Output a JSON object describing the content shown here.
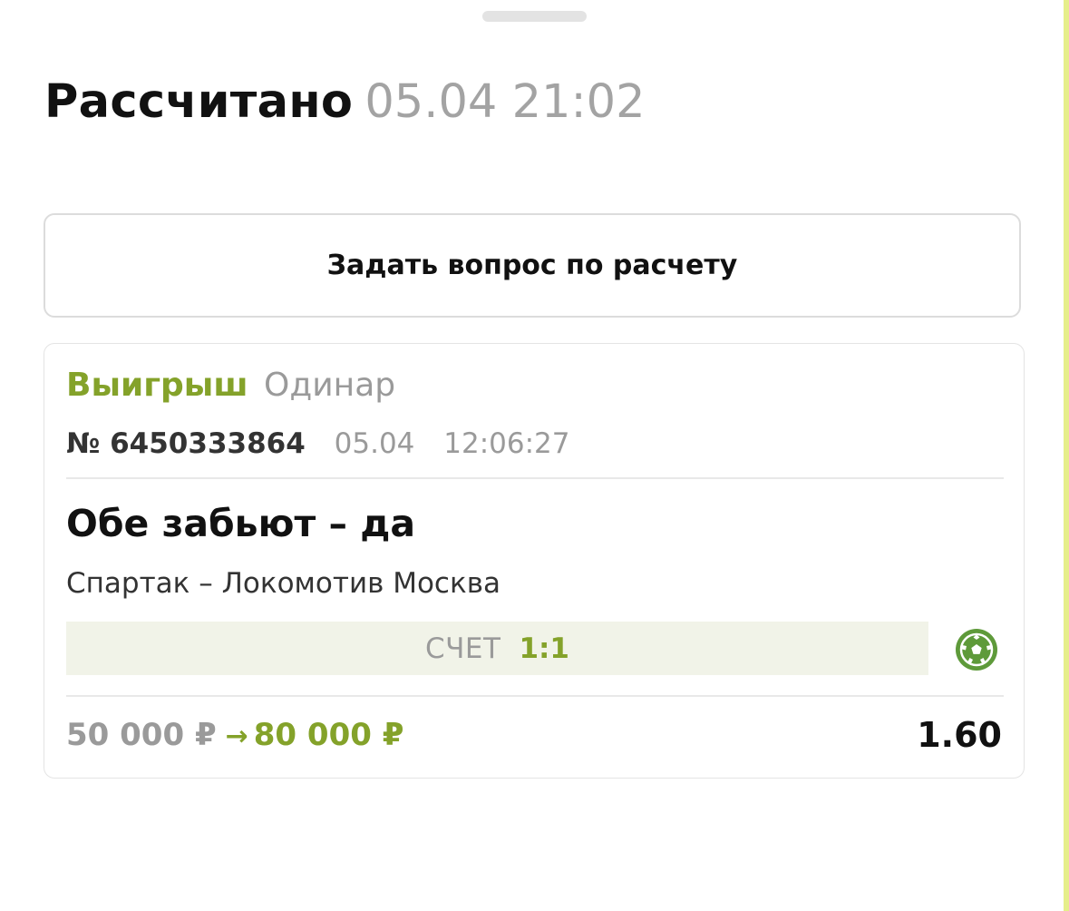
{
  "header": {
    "status_title": "Рассчитано",
    "settled_datetime": "05.04 21:02"
  },
  "actions": {
    "ask_question_label": "Задать вопрос по расчету"
  },
  "bet": {
    "result": "Выигрыш",
    "bet_type": "Одинар",
    "number": "№ 6450333864",
    "placed_date": "05.04",
    "placed_time": "12:06:27",
    "outcome": "Обе забьют – да",
    "event": "Спартак – Локомотив Москва",
    "score_label": "СЧЕТ",
    "score": "1:1",
    "sport_icon": "soccer-ball-icon",
    "stake": "50 000 ₽",
    "arrow": "→",
    "payout": "80 000 ₽",
    "odds": "1.60"
  },
  "colors": {
    "win_green": "#84a22a",
    "score_bar_bg": "#f1f3e8",
    "icon_green": "#5e9a3a",
    "muted_text": "#9a9a9a",
    "edge_strip": "#e6ee8a"
  }
}
